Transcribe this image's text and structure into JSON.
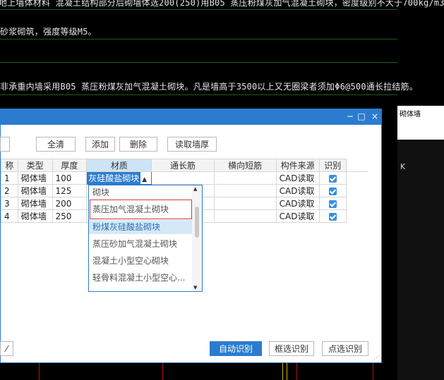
{
  "cad": {
    "line1": "地上墙体材料 混凝土结构部分后砌墙体选200(250)用B05 蒸压粉煤灰加气混凝土砌块，密度级别不大于700kg/m3;",
    "line2": "砂浆砌筑，强度等级M5。",
    "line3": "非承重内墙采用B05 蒸压粉煤灰加气混凝土砌块。凡是墙高于3500以上又无圈梁者须加Φ6@500通长拉结筋。",
    "side_tab": "砌体墙",
    "side_k": "K"
  },
  "window": {
    "minimize": "−",
    "maximize": "□",
    "close": "×"
  },
  "toolbar": {
    "clear_all": "全清",
    "add": "添加",
    "delete": "删除",
    "read_thickness": "读取墙厚"
  },
  "table": {
    "columns": [
      "称",
      "类型",
      "厚度",
      "材质",
      "通长筋",
      "横向短筋",
      "构件来源",
      "识别"
    ],
    "rows": [
      {
        "id": "1",
        "type": "砌体墙",
        "thickness": "100",
        "material": "灰硅酸盐砌块",
        "long_bar": "",
        "short_bar": "",
        "source": "CAD读取",
        "identify": true
      },
      {
        "id": "2",
        "type": "砌体墙",
        "thickness": "125",
        "material": "",
        "long_bar": "",
        "short_bar": "",
        "source": "CAD读取",
        "identify": true
      },
      {
        "id": "3",
        "type": "砌体墙",
        "thickness": "200",
        "material": "",
        "long_bar": "",
        "short_bar": "",
        "source": "CAD读取",
        "identify": true
      },
      {
        "id": "4",
        "type": "砌体墙",
        "thickness": "250",
        "material": "",
        "long_bar": "",
        "short_bar": "",
        "source": "CAD读取",
        "identify": true
      }
    ]
  },
  "dropdown": {
    "options": [
      "砌块",
      "蒸压加气混凝土砌块",
      "粉煤灰硅酸盐砌块",
      "蒸压砂加气混凝土砌块",
      "混凝土小型空心砌块",
      "轻骨料混凝土小型空心..."
    ],
    "selected_index": 2,
    "highlighted_index": 1
  },
  "bottom": {
    "auto_identify": "自动识别",
    "box_identify": "框选识别",
    "point_identify": "点选识别",
    "left_icon": "⁄"
  }
}
